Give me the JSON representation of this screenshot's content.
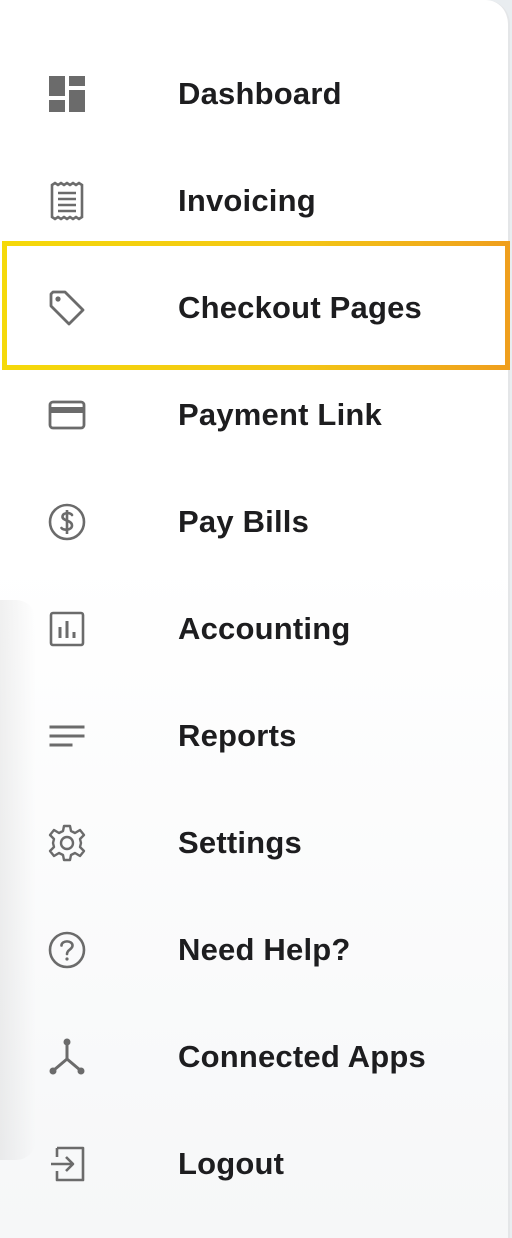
{
  "nav": {
    "items": [
      {
        "id": "dashboard",
        "label": "Dashboard",
        "icon": "dashboard-icon"
      },
      {
        "id": "invoicing",
        "label": "Invoicing",
        "icon": "receipt-icon"
      },
      {
        "id": "checkout-pages",
        "label": "Checkout Pages",
        "icon": "tag-icon",
        "active": true
      },
      {
        "id": "payment-link",
        "label": "Payment Link",
        "icon": "credit-card-icon"
      },
      {
        "id": "pay-bills",
        "label": "Pay Bills",
        "icon": "dollar-circle-icon"
      },
      {
        "id": "accounting",
        "label": "Accounting",
        "icon": "bar-chart-icon"
      },
      {
        "id": "reports",
        "label": "Reports",
        "icon": "lines-icon"
      },
      {
        "id": "settings",
        "label": "Settings",
        "icon": "gear-icon"
      },
      {
        "id": "need-help",
        "label": "Need Help?",
        "icon": "question-circle-icon"
      },
      {
        "id": "connected-apps",
        "label": "Connected Apps",
        "icon": "hub-icon"
      },
      {
        "id": "logout",
        "label": "Logout",
        "icon": "logout-icon"
      }
    ]
  },
  "colors": {
    "icon": "#6b6b6b",
    "label": "#1d1d1f",
    "highlight_start": "#f5d90a",
    "highlight_end": "#ef9f1d"
  }
}
